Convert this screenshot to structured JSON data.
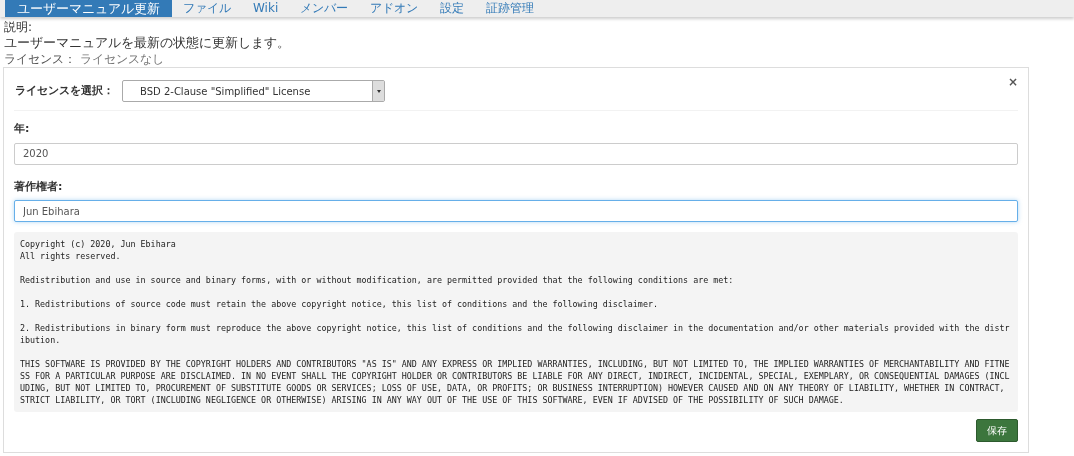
{
  "nav_tabs": [
    {
      "label": "ユーザーマニュアル更新",
      "selected": true
    },
    {
      "label": "ファイル",
      "selected": false
    },
    {
      "label": "Wiki",
      "selected": false
    },
    {
      "label": "メンバー",
      "selected": false
    },
    {
      "label": "アドオン",
      "selected": false
    },
    {
      "label": "設定",
      "selected": false
    },
    {
      "label": "証跡管理",
      "selected": false
    }
  ],
  "description": {
    "label": "説明:",
    "text": "ユーザーマニュアルを最新の状態に更新します。"
  },
  "license_status": {
    "label": "ライセンス：",
    "value": "ライセンスなし"
  },
  "panel": {
    "close": "×",
    "license_select": {
      "label": "ライセンスを選択：",
      "value": "BSD 2-Clause \"Simplified\" License"
    },
    "fields": [
      {
        "label": "年:",
        "value": "2020",
        "focused": false
      },
      {
        "label": "著作権者:",
        "value": "Jun Ebihara",
        "focused": true
      }
    ],
    "license_text": [
      "Copyright (c) 2020, Jun Ebihara\nAll rights reserved.",
      "Redistribution and use in source and binary forms, with or without modification, are permitted provided that the following conditions are met:",
      "1. Redistributions of source code must retain the above copyright notice, this list of conditions and the following disclaimer.",
      "2. Redistributions in binary form must reproduce the above copyright notice, this list of conditions and the following disclaimer in the documentation and/or other materials provided with the distribution.",
      "THIS SOFTWARE IS PROVIDED BY THE COPYRIGHT HOLDERS AND CONTRIBUTORS \"AS IS\" AND ANY EXPRESS OR IMPLIED WARRANTIES, INCLUDING, BUT NOT LIMITED TO, THE IMPLIED WARRANTIES OF MERCHANTABILITY AND FITNESS FOR A PARTICULAR PURPOSE ARE DISCLAIMED. IN NO EVENT SHALL THE COPYRIGHT HOLDER OR CONTRIBUTORS BE LIABLE FOR ANY DIRECT, INDIRECT, INCIDENTAL, SPECIAL, EXEMPLARY, OR CONSEQUENTIAL DAMAGES (INCLUDING, BUT NOT LIMITED TO, PROCUREMENT OF SUBSTITUTE GOODS OR SERVICES; LOSS OF USE, DATA, OR PROFITS; OR BUSINESS INTERRUPTION) HOWEVER CAUSED AND ON ANY THEORY OF LIABILITY, WHETHER IN CONTRACT, STRICT LIABILITY, OR TORT (INCLUDING NEGLIGENCE OR OTHERWISE) ARISING IN ANY WAY OUT OF THE USE OF THIS SOFTWARE, EVEN IF ADVISED OF THE POSSIBILITY OF SUCH DAMAGE."
    ],
    "save_button": "保存"
  }
}
